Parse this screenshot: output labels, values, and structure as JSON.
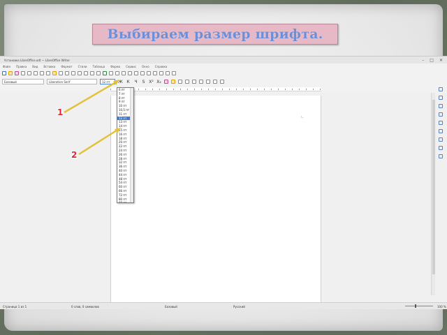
{
  "slide": {
    "title": "Выбираем размер шрифта."
  },
  "window": {
    "title": "Установка LibreOffice.odt — LibreOffice Writer",
    "controls": [
      "–",
      "□",
      "✕"
    ]
  },
  "menu": [
    "Файл",
    "Правка",
    "Вид",
    "Вставка",
    "Формат",
    "Стили",
    "Таблица",
    "Форма",
    "Сервис",
    "Окно",
    "Справка"
  ],
  "formatting": {
    "style": "Базовый",
    "font": "Liberation Serif",
    "size": "12 пт",
    "buttons": [
      "Ж",
      "К",
      "Ч",
      "S",
      "X²",
      "X₂"
    ]
  },
  "font_sizes": [
    "6 пт",
    "7 пт",
    "8 пт",
    "9 пт",
    "10 пт",
    "10,5 пт",
    "11 пт",
    "12 пт",
    "13 пт",
    "14 пт",
    "15 пт",
    "16 пт",
    "18 пт",
    "20 пт",
    "22 пт",
    "24 пт",
    "26 пт",
    "28 пт",
    "32 пт",
    "36 пт",
    "40 пт",
    "44 пт",
    "48 пт",
    "54 пт",
    "60 пт",
    "66 пт",
    "72 пт",
    "80 пт",
    "88 пт",
    "96 пт"
  ],
  "font_sizes_selected_index": 7,
  "callouts": [
    "1",
    "2"
  ],
  "status": {
    "page": "Страница 1 из 1",
    "words": "0 слов, 0 символов",
    "style": "Базовый",
    "lang": "Русский",
    "zoom": "100 %"
  },
  "colors": {
    "title_bg": "#e7b9c6",
    "title_text": "#6c8fd8",
    "arrow": "#e2c23a",
    "callout_number": "#e0263a",
    "selection": "#3d7bd1"
  }
}
